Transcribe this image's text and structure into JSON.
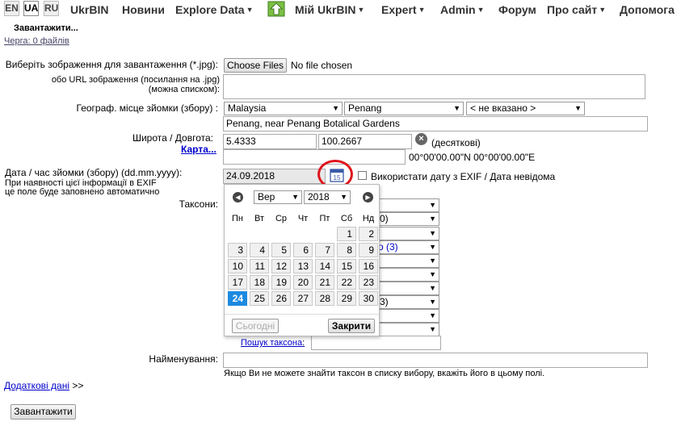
{
  "nav": {
    "langs": [
      "EN",
      "UA",
      "RU"
    ],
    "items": [
      "UkrBIN",
      "Новини",
      "Explore Data",
      "Мій UkrBIN",
      "Expert",
      "Admin",
      "Форум",
      "Про сайт",
      "Допомога"
    ]
  },
  "upload": {
    "status": "Завантажити...",
    "queue": "Черга: 0 файлів"
  },
  "form": {
    "file_label": "Виберіть зображення для завантаження (*.jpg):",
    "file_button": "Choose Files",
    "file_status": "No file chosen",
    "url_label_1": "обо URL зображення (посилання на .jpg)",
    "url_label_2": "(можна списком):",
    "geo_label": "Географ. місце зйомки (збору) :",
    "country": "Malaysia",
    "region": "Penang",
    "district": "< не вказано >",
    "locality": "Penang, near Penang Botalical Gardens",
    "coords_label": "Широта / Довгота:",
    "map_link": "Карта...",
    "lat": "5.4333",
    "lon": "100.2667",
    "decimal_label": "(десяткові)",
    "dms": "00°00'00.00\"N 00°00'00.00\"E",
    "date_label": "Дата / час зйомки (збору) (dd.mm.yyyy):",
    "date_note_1": "При наявності цієї інформації в EXIF",
    "date_note_2": "це поле буде заповнено автоматично",
    "date_value": "24.09.2018",
    "exif_label": "Використати дату з EXIF / Дата невідома",
    "taxa_label": "Таксони:",
    "taxa_fragments": [
      "0)",
      "о (3)",
      "3)"
    ],
    "taxon_search": "Пошук таксона",
    "name_label": "Найменування:",
    "name_hint": "Якщо Ви не можете знайти таксон в списку вибору, вкажіть його в цьому полі.",
    "additional_link": "Додаткові дані",
    "additional_suffix": ">>",
    "submit": "Завантажити"
  },
  "calendar": {
    "month": "Вер",
    "year": "2018",
    "weekdays": [
      "Пн",
      "Вт",
      "Ср",
      "Чт",
      "Пт",
      "Сб",
      "Нд"
    ],
    "weeks": [
      [
        "",
        "",
        "",
        "",
        "",
        "1",
        "2"
      ],
      [
        "3",
        "4",
        "5",
        "6",
        "7",
        "8",
        "9"
      ],
      [
        "10",
        "11",
        "12",
        "13",
        "14",
        "15",
        "16"
      ],
      [
        "17",
        "18",
        "19",
        "20",
        "21",
        "22",
        "23"
      ],
      [
        "24",
        "25",
        "26",
        "27",
        "28",
        "29",
        "30"
      ]
    ],
    "selected_day": "24",
    "today_button": "Сьогодні",
    "close_button": "Закрити"
  },
  "colors": {
    "selected_day": "#1c8ae0",
    "highlight_circle": "#e0141c",
    "link": "#0000cc"
  }
}
